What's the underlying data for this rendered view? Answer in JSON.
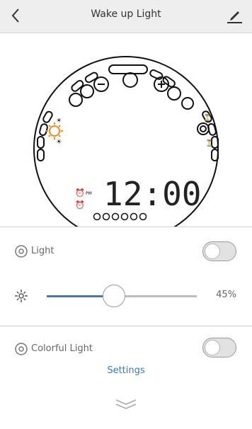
{
  "header": {
    "title": "Wake up Light",
    "back_icon": "chevron-left-icon",
    "edit_icon": "pencil-icon"
  },
  "clock": {
    "time": "12:00",
    "pm": "PM"
  },
  "light": {
    "label": "Light",
    "enabled": false,
    "brightness_percent": 45,
    "brightness_text": "45%"
  },
  "colorful_light": {
    "label": "Colorful Light",
    "enabled": false,
    "settings_label": "Settings"
  },
  "colors": {
    "accent": "#3a7ac1",
    "orange": "#f08a24"
  }
}
